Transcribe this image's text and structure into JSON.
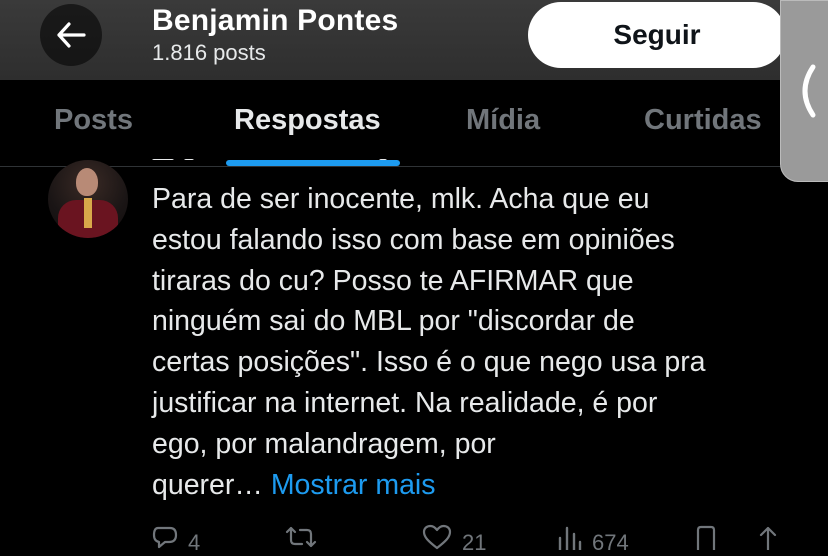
{
  "header": {
    "title": "Benjamin Pontes",
    "subtitle": "1.816 posts",
    "follow_label": "Seguir"
  },
  "tabs": [
    {
      "label": "Posts",
      "active": false
    },
    {
      "label": "Respostas",
      "active": true
    },
    {
      "label": "Mídia",
      "active": false
    },
    {
      "label": "Curtidas",
      "active": false
    }
  ],
  "post": {
    "text": "Para de ser inocente, mlk. Acha que eu\nestou falando isso com base em opiniões\ntiraras do cu? Posso te AFIRMAR que\nninguém sai do MBL por \"discordar de\ncertas posições\". Isso é o que nego usa pra\njustificar na internet. Na realidade, é por\nego, por malandragem, por\nquerer…",
    "show_more": "Mostrar mais",
    "actions": {
      "replies": "4",
      "reposts": "",
      "likes": "21",
      "views": "674"
    }
  },
  "icons": {
    "back": "arrow-left-icon",
    "handle": "chevron-left-icon",
    "reply": "speech-bubble-icon",
    "repost": "repost-icon",
    "like": "heart-icon",
    "views": "bar-chart-icon",
    "bookmark": "bookmark-icon",
    "share": "share-icon"
  },
  "colors": {
    "accent": "#1d9bf0",
    "background": "#000000",
    "text": "#e7e9ea",
    "muted": "#71767b"
  }
}
